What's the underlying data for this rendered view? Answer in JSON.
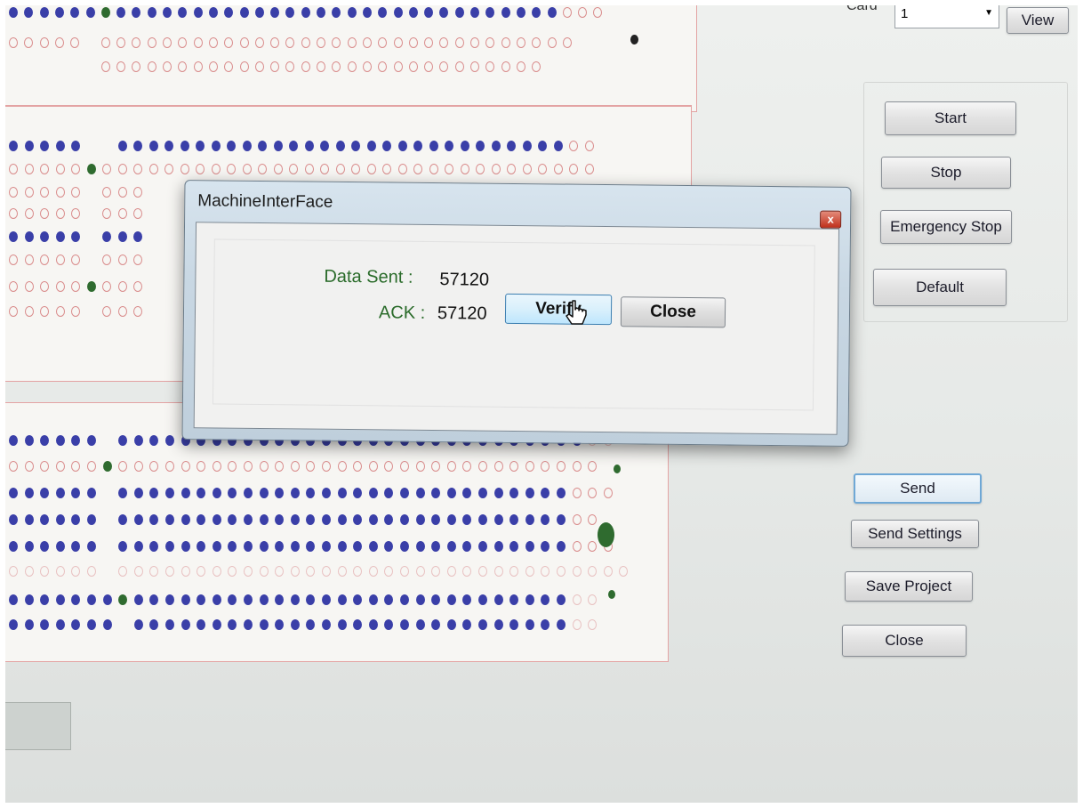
{
  "window": {
    "card_label": "Card",
    "card_value": "1",
    "view_button": "View"
  },
  "controls": {
    "start": "Start",
    "stop": "Stop",
    "emergency_stop": "Emergency Stop",
    "default": "Default",
    "send": "Send",
    "send_settings": "Send Settings",
    "save_project": "Save Project",
    "close": "Close"
  },
  "dialog": {
    "title": "MachineInterFace",
    "close_glyph": "x",
    "data_sent_label": "Data Sent :",
    "data_sent_value": "57120",
    "ack_label": "ACK :",
    "ack_value": "57120",
    "verify_button": "Verify",
    "close_button": "Close"
  },
  "colors": {
    "dot_on": "#3a3fa8",
    "dot_off": "#d98b8b",
    "dot_marker": "#2f6b2f",
    "label_green": "#2a6b2a"
  }
}
